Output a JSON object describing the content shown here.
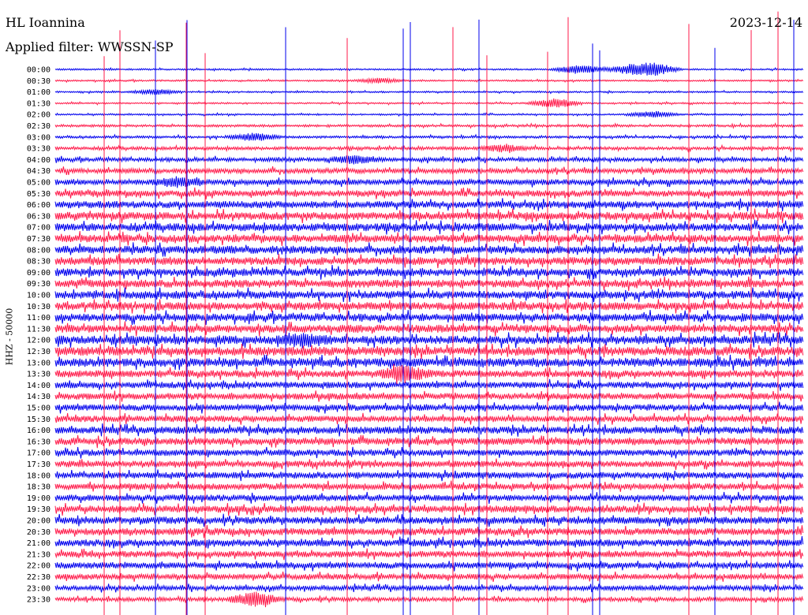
{
  "header": {
    "station": "HL Ioannina",
    "date": "2023-12-14",
    "filter": "Applied filter: WWSSN-SP"
  },
  "chart_data": {
    "type": "line",
    "title": "HL Ioannina",
    "ylabel": "HHZ - 50000",
    "colors": {
      "even": "#0000ee",
      "odd": "#ff1a4a",
      "background": "#ffffff"
    },
    "tick_labels": [
      "00:00",
      "00:30",
      "01:00",
      "01:30",
      "02:00",
      "02:30",
      "03:00",
      "03:30",
      "04:00",
      "04:30",
      "05:00",
      "05:30",
      "06:00",
      "06:30",
      "07:00",
      "07:30",
      "08:00",
      "08:30",
      "09:00",
      "09:30",
      "10:00",
      "10:30",
      "11:00",
      "11:30",
      "12:00",
      "12:30",
      "13:00",
      "13:30",
      "14:00",
      "14:30",
      "15:00",
      "15:30",
      "16:00",
      "16:30",
      "17:00",
      "17:30",
      "18:00",
      "18:30",
      "19:00",
      "19:30",
      "20:00",
      "20:30",
      "21:00",
      "21:30",
      "22:00",
      "22:30",
      "23:00",
      "23:30"
    ],
    "row_amplitude": [
      2,
      2,
      2,
      2,
      2,
      3,
      3,
      4,
      5,
      6,
      7,
      8,
      9,
      10,
      10,
      10,
      10,
      10,
      10,
      10,
      10,
      10,
      10,
      10,
      11,
      11,
      11,
      9,
      8,
      8,
      8,
      8,
      9,
      9,
      8,
      8,
      8,
      8,
      8,
      9,
      9,
      9,
      9,
      8,
      8,
      7,
      6,
      5
    ],
    "events": [
      {
        "row": 0,
        "minute": 24,
        "amp": 16
      },
      {
        "row": 0,
        "minute": 21,
        "amp": 12
      },
      {
        "row": 0,
        "minute": 23,
        "amp": 10
      },
      {
        "row": 1,
        "minute": 13,
        "amp": 6
      },
      {
        "row": 2,
        "minute": 4,
        "amp": 6
      },
      {
        "row": 3,
        "minute": 20,
        "amp": 12
      },
      {
        "row": 4,
        "minute": 24,
        "amp": 8
      },
      {
        "row": 6,
        "minute": 8,
        "amp": 10
      },
      {
        "row": 7,
        "minute": 18,
        "amp": 8
      },
      {
        "row": 8,
        "minute": 12,
        "amp": 10
      },
      {
        "row": 10,
        "minute": 5,
        "amp": 10
      },
      {
        "row": 24,
        "minute": 10,
        "amp": 14
      },
      {
        "row": 27,
        "minute": 14,
        "amp": 18
      },
      {
        "row": 47,
        "minute": 8,
        "amp": 18
      }
    ],
    "spikes_blue": [
      197,
      237,
      362,
      511,
      520,
      607,
      751,
      760,
      906,
      1006
    ],
    "spikes_red": [
      132,
      152,
      236,
      260,
      440,
      574,
      617,
      694,
      720,
      873,
      952,
      986
    ]
  }
}
